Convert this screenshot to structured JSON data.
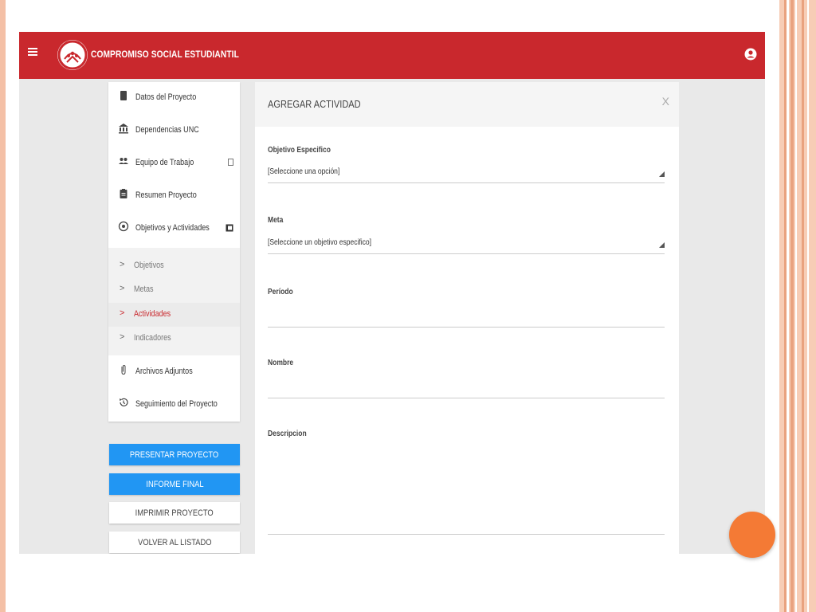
{
  "header": {
    "title": "COMPROMISO SOCIAL ESTUDIANTIL"
  },
  "sidebar": {
    "items": [
      {
        "label": "Datos del Proyecto",
        "icon": "document-icon"
      },
      {
        "label": "Dependencias UNC",
        "icon": "institution-icon"
      },
      {
        "label": "Equipo de Trabajo",
        "icon": "group-icon"
      },
      {
        "label": "Resumen Proyecto",
        "icon": "clipboard-icon"
      },
      {
        "label": "Objetivos y Actividades",
        "icon": "target-icon"
      },
      {
        "label": "Archivos Adjuntos",
        "icon": "paperclip-icon"
      },
      {
        "label": "Seguimiento del Proyecto",
        "icon": "history-icon"
      }
    ],
    "subitems": [
      {
        "label": "Objetivos",
        "active": false
      },
      {
        "label": "Metas",
        "active": false
      },
      {
        "label": "Actividades",
        "active": true
      },
      {
        "label": "Indicadores",
        "active": false
      }
    ]
  },
  "buttons": {
    "presentar": "PRESENTAR PROYECTO",
    "informe": "INFORME FINAL",
    "imprimir": "IMPRIMIR PROYECTO",
    "volver": "VOLVER AL LISTADO"
  },
  "panel": {
    "title": "AGREGAR ACTIVIDAD",
    "close": "X",
    "fields": {
      "objetivo": {
        "label": "Objetivo Especifico",
        "value": "[Seleccione una opción]"
      },
      "meta": {
        "label": "Meta",
        "value": "[Seleccione un objetivo especifico]"
      },
      "periodo": {
        "label": "Período",
        "value": ""
      },
      "nombre": {
        "label": "Nombre",
        "value": ""
      },
      "descripcion": {
        "label": "Descripcion",
        "value": ""
      }
    }
  },
  "colors": {
    "topbar": "#c9282d",
    "accent_active": "#c9282d",
    "primary_button": "#2196f3",
    "fab": "#f47a35"
  }
}
